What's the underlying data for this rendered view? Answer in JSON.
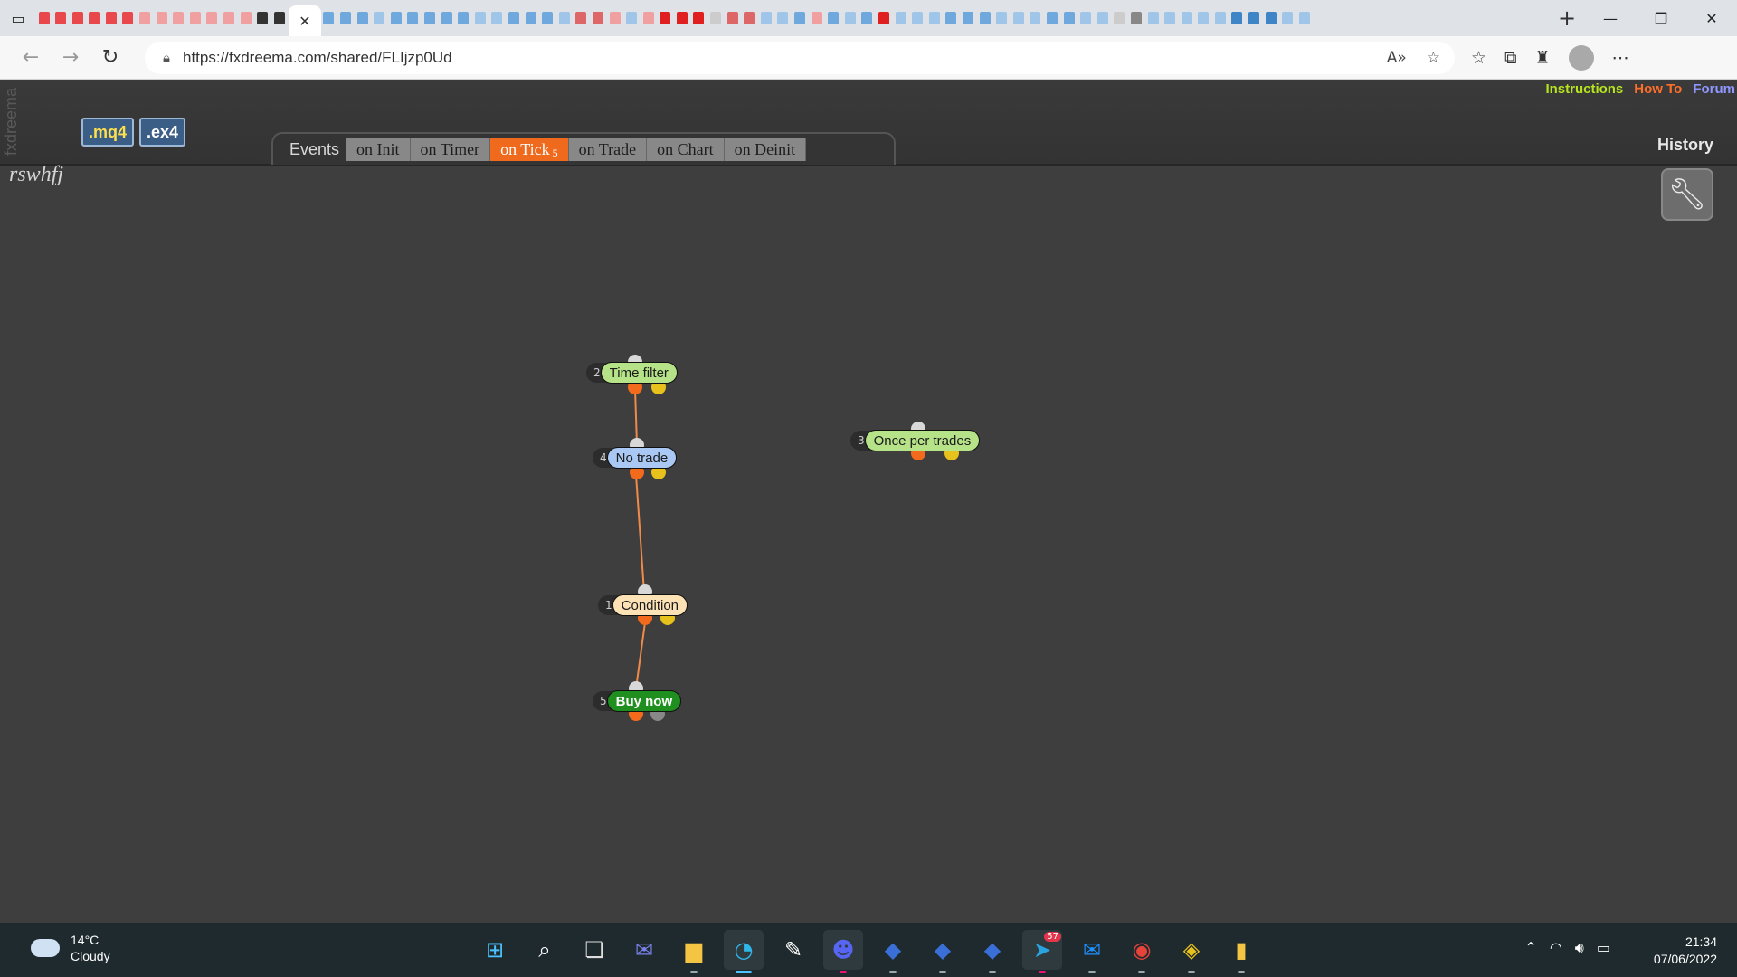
{
  "browser": {
    "url": "https://fxdreema.com/shared/FLIjzp0Ud",
    "mini_tab_colors": [
      "#e8474c",
      "#e8474c",
      "#e8474c",
      "#e8474c",
      "#e8474c",
      "#e8474c",
      "#f0a0a0",
      "#f0a0a0",
      "#f0a0a0",
      "#f0a0a0",
      "#f0a0a0",
      "#f0a0a0",
      "#f0a0a0",
      "#333333",
      "#333333",
      "#6fa8dc",
      "#6fa8dc",
      "#6fa8dc",
      "#9fc5e8",
      "#6fa8dc",
      "#6fa8dc",
      "#6fa8dc",
      "#6fa8dc",
      "#6fa8dc",
      "#9fc5e8",
      "#9fc5e8",
      "#6fa8dc",
      "#6fa8dc",
      "#6fa8dc",
      "#9fc5e8",
      "#d66",
      "#d66",
      "#f0a0a0",
      "#9fc5e8",
      "#f0a0a0",
      "#e02020",
      "#e02020",
      "#e02020",
      "#cccccc",
      "#d66",
      "#d66",
      "#9fc5e8",
      "#9fc5e8",
      "#6fa8dc",
      "#f0a0a0",
      "#6fa8dc",
      "#9fc5e8",
      "#6fa8dc",
      "#e02020",
      "#9fc5e8",
      "#9fc5e8",
      "#9fc5e8",
      "#6fa8dc",
      "#6fa8dc",
      "#6fa8dc",
      "#9fc5e8",
      "#9fc5e8",
      "#9fc5e8",
      "#6fa8dc",
      "#6fa8dc",
      "#9fc5e8",
      "#9fc5e8",
      "#cccccc",
      "#888888",
      "#9fc5e8",
      "#9fc5e8",
      "#9fc5e8",
      "#9fc5e8",
      "#9fc5e8",
      "#3d85c6",
      "#3d85c6",
      "#3d85c6",
      "#9fc5e8",
      "#9fc5e8"
    ]
  },
  "page": {
    "brand": "fxdreema",
    "project_name": "rswhfj",
    "file_buttons": {
      "mq4": ".mq4",
      "ex4": ".ex4"
    },
    "links": {
      "instructions": "Instructions",
      "how_to": "How To",
      "forum": "Forum"
    },
    "history": "History",
    "events_label": "Events",
    "event_tabs": [
      {
        "label": "on Init"
      },
      {
        "label": "on Timer"
      },
      {
        "label": "on Tick",
        "sub": "5",
        "active": true
      },
      {
        "label": "on Trade"
      },
      {
        "label": "on Chart"
      },
      {
        "label": "on Deinit"
      }
    ]
  },
  "flow": {
    "blocks": [
      {
        "id": "2",
        "label": "Time filter",
        "color": "#b6e388",
        "text_color": "#1a1a1a"
      },
      {
        "id": "4",
        "label": "No trade",
        "color": "#a9c8f4",
        "text_color": "#1a1a1a"
      },
      {
        "id": "3",
        "label": "Once per trades",
        "color": "#b6e388",
        "text_color": "#1a1a1a"
      },
      {
        "id": "1",
        "label": "Condition",
        "color": "#fde2b6",
        "text_color": "#1a1a1a"
      },
      {
        "id": "5",
        "label": "Buy now",
        "color": "#1f8f1f",
        "text_color": "#ffffff"
      }
    ]
  },
  "taskbar": {
    "temperature": "14°C",
    "condition": "Cloudy",
    "time": "21:34",
    "date": "07/06/2022",
    "telegram_badge": "57"
  }
}
